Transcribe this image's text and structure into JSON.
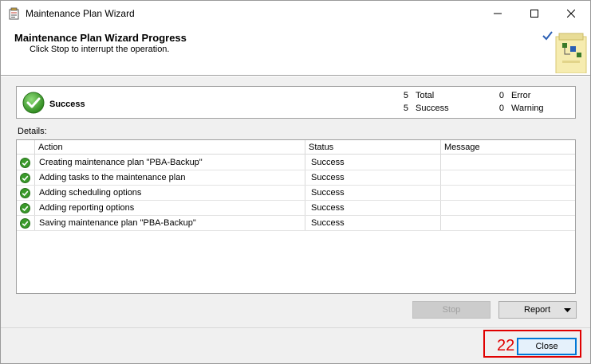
{
  "window": {
    "title": "Maintenance Plan Wizard",
    "controls": [
      "minimize-icon",
      "maximize-icon",
      "close-icon"
    ]
  },
  "header": {
    "title": "Maintenance Plan Wizard Progress",
    "subtitle": "Click Stop to interrupt the operation."
  },
  "summary": {
    "status": "Success",
    "counts": [
      {
        "value": "5",
        "label": "Total"
      },
      {
        "value": "5",
        "label": "Success"
      },
      {
        "value": "0",
        "label": "Error"
      },
      {
        "value": "0",
        "label": "Warning"
      }
    ]
  },
  "details": {
    "label": "Details:",
    "columns": [
      "Action",
      "Status",
      "Message"
    ],
    "rows": [
      {
        "action": "Creating maintenance plan \"PBA-Backup\"",
        "status": "Success",
        "message": ""
      },
      {
        "action": "Adding tasks to the maintenance plan",
        "status": "Success",
        "message": ""
      },
      {
        "action": "Adding scheduling options",
        "status": "Success",
        "message": ""
      },
      {
        "action": "Adding reporting options",
        "status": "Success",
        "message": ""
      },
      {
        "action": "Saving maintenance plan \"PBA-Backup\"",
        "status": "Success",
        "message": ""
      }
    ]
  },
  "buttons": {
    "stop": "Stop",
    "report": "Report",
    "close": "Close"
  },
  "annotation": {
    "number": "22",
    "color": "#e00000"
  },
  "colors": {
    "success_green": "#3a9a2a",
    "accent_blue": "#0078d7"
  }
}
